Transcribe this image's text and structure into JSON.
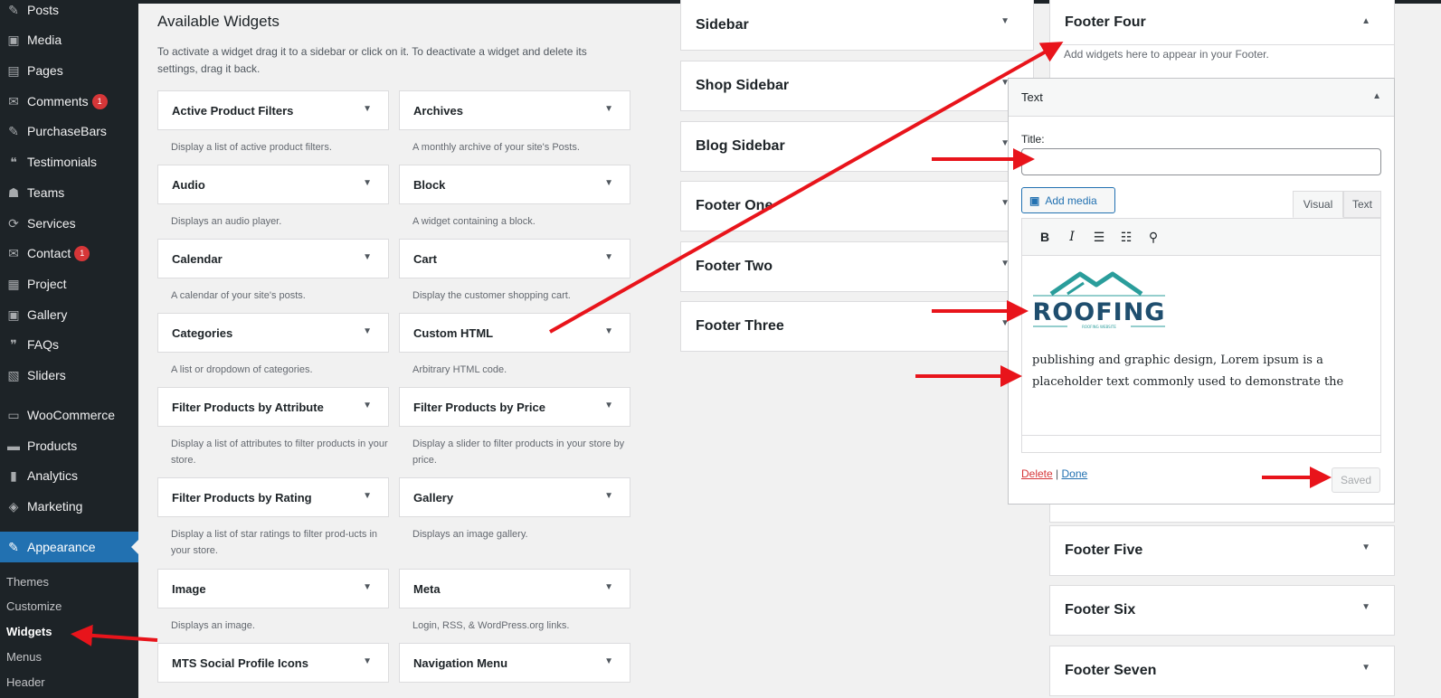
{
  "menu": {
    "items": [
      {
        "label": "Posts",
        "icon": "pin-icon",
        "glyph": "✎",
        "badge": ""
      },
      {
        "label": "Media",
        "icon": "media-icon",
        "glyph": "▣",
        "badge": ""
      },
      {
        "label": "Pages",
        "icon": "pages-icon",
        "glyph": "▤",
        "badge": ""
      },
      {
        "label": "Comments",
        "icon": "comments-icon",
        "glyph": "✉",
        "badge": "1"
      },
      {
        "label": "PurchaseBars",
        "icon": "pin-icon",
        "glyph": "✎",
        "badge": ""
      },
      {
        "label": "Testimonials",
        "icon": "testimonials-icon",
        "glyph": "❝",
        "badge": ""
      },
      {
        "label": "Teams",
        "icon": "teams-icon",
        "glyph": "☗",
        "badge": ""
      },
      {
        "label": "Services",
        "icon": "services-icon",
        "glyph": "⟳",
        "badge": ""
      },
      {
        "label": "Contact",
        "icon": "mail-icon",
        "glyph": "✉",
        "badge": "1"
      },
      {
        "label": "Project",
        "icon": "project-icon",
        "glyph": "▦",
        "badge": ""
      },
      {
        "label": "Gallery",
        "icon": "gallery-icon",
        "glyph": "▣",
        "badge": ""
      },
      {
        "label": "FAQs",
        "icon": "faq-icon",
        "glyph": "❞",
        "badge": ""
      },
      {
        "label": "Sliders",
        "icon": "sliders-icon",
        "glyph": "▧",
        "badge": ""
      },
      {
        "label": "WooCommerce",
        "icon": "woo-icon",
        "glyph": "▭",
        "badge": ""
      },
      {
        "label": "Products",
        "icon": "products-icon",
        "glyph": "▬",
        "badge": ""
      },
      {
        "label": "Analytics",
        "icon": "analytics-icon",
        "glyph": "▮",
        "badge": ""
      },
      {
        "label": "Marketing",
        "icon": "marketing-icon",
        "glyph": "◈",
        "badge": ""
      },
      {
        "label": "Appearance",
        "icon": "appearance-icon",
        "glyph": "✎",
        "badge": ""
      }
    ],
    "submenu": [
      "Themes",
      "Customize",
      "Widgets",
      "Menus",
      "Header"
    ],
    "current_sub": "Widgets"
  },
  "available": {
    "title": "Available Widgets",
    "description": "To activate a widget drag it to a sidebar or click on it. To deactivate a widget and delete its settings, drag it back.",
    "widgets": [
      {
        "name": "Active Product Filters",
        "desc": "Display a list of active product filters."
      },
      {
        "name": "Archives",
        "desc": "A monthly archive of your site's Posts."
      },
      {
        "name": "Audio",
        "desc": "Displays an audio player."
      },
      {
        "name": "Block",
        "desc": "A widget containing a block."
      },
      {
        "name": "Calendar",
        "desc": "A calendar of your site's posts."
      },
      {
        "name": "Cart",
        "desc": "Display the customer shopping cart."
      },
      {
        "name": "Categories",
        "desc": "A list or dropdown of categories."
      },
      {
        "name": "Custom HTML",
        "desc": "Arbitrary HTML code."
      },
      {
        "name": "Filter Products by Attribute",
        "desc": "Display a list of attributes to filter products in your store."
      },
      {
        "name": "Filter Products by Price",
        "desc": "Display a slider to filter products in your store by price."
      },
      {
        "name": "Filter Products by Rating",
        "desc": "Display a list of star ratings to filter prod-ucts in your store."
      },
      {
        "name": "Gallery",
        "desc": "Displays an image gallery."
      },
      {
        "name": "Image",
        "desc": "Displays an image."
      },
      {
        "name": "Meta",
        "desc": "Login, RSS, & WordPress.org links."
      },
      {
        "name": "MTS Social Profile Icons",
        "desc": ""
      },
      {
        "name": "Navigation Menu",
        "desc": ""
      }
    ]
  },
  "sidebars_left": [
    "Sidebar",
    "Shop Sidebar",
    "Blog Sidebar",
    "Footer One",
    "Footer Two",
    "Footer Three"
  ],
  "sidebars_right": {
    "open": {
      "title": "Footer Four",
      "description": "Add widgets here to appear in your Footer."
    },
    "closed": [
      "Footer Five",
      "Footer Six",
      "Footer Seven"
    ]
  },
  "editor": {
    "widget_title": "Text",
    "title_label": "Title:",
    "title_value": "",
    "add_media": "Add media",
    "tab_visual": "Visual",
    "tab_text": "Text",
    "logo_text": "ROOFING",
    "logo_tagline": "ROOFING WEBSITE",
    "content": "publishing and graphic design, Lorem ipsum is a placeholder text commonly used to demonstrate the",
    "delete": "Delete",
    "separator": "|",
    "done": "Done",
    "saved": "Saved"
  },
  "colors": {
    "admin_dark": "#1d2327",
    "accent": "#2271b1",
    "badge": "#d63638",
    "arrow": "#e8141b",
    "logo_teal": "#2a9d9b",
    "logo_navy": "#1f4e6e"
  }
}
